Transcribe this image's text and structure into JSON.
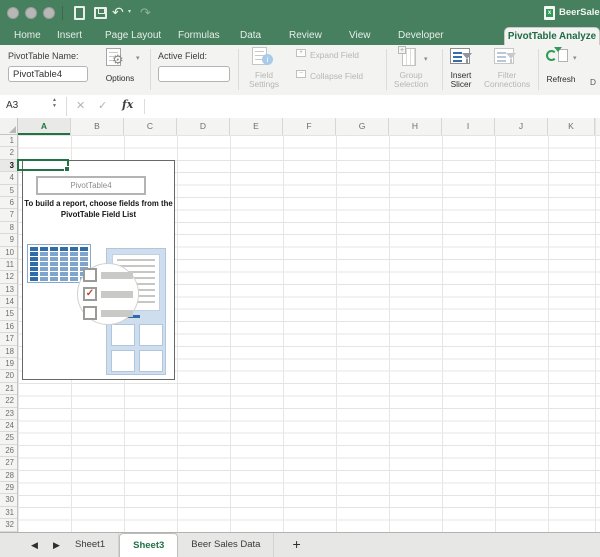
{
  "titlebar": {
    "title": "BeerSalesD"
  },
  "icons": {
    "undo_glyph": "↶",
    "redo_glyph": "↷",
    "caret": "▾",
    "stepper_up": "▲",
    "stepper_down": "▼",
    "cancel": "✕",
    "confirm": "✓",
    "check": "✓",
    "prev": "◀",
    "next": "▶",
    "gear": "⚙",
    "info": "i",
    "plus_small": "+",
    "minus_small": "−",
    "excel_x": "x"
  },
  "ribbon_tabs": {
    "items": [
      "Home",
      "Insert",
      "Page Layout",
      "Formulas",
      "Data",
      "Review",
      "View",
      "Developer",
      "PivotTable Analyze"
    ],
    "active": "PivotTable Analyze"
  },
  "ribbon": {
    "pivottable_name_label": "PivotTable Name:",
    "pivottable_name_value": "PivotTable4",
    "options_label": "Options",
    "active_field_label": "Active Field:",
    "active_field_value": "",
    "field_settings_1": "Field",
    "field_settings_2": "Settings",
    "expand_field": "Expand Field",
    "collapse_field": "Collapse Field",
    "group_selection_1": "Group",
    "group_selection_2": "Selection",
    "insert_slicer_1": "Insert",
    "insert_slicer_2": "Slicer",
    "filter_connections_1": "Filter",
    "filter_connections_2": "Connections",
    "refresh_label": "Refresh",
    "clipped_group_label": "D"
  },
  "formula_bar": {
    "cell_reference": "A3",
    "fx_label": "fx"
  },
  "grid": {
    "columns": [
      "A",
      "B",
      "C",
      "D",
      "E",
      "F",
      "G",
      "H",
      "I",
      "J",
      "K"
    ],
    "row_count": 32,
    "selected_column": "A",
    "selected_row": 3,
    "selected_cell": "A3"
  },
  "pivot_placeholder": {
    "title": "PivotTable4",
    "message_line1": "To build a report, choose fields from the",
    "message_line2": "PivotTable Field List"
  },
  "sheet_tabs": {
    "items": [
      {
        "label": "Sheet1",
        "active": false
      },
      {
        "label": "Sheet3",
        "active": true
      },
      {
        "label": "Beer Sales Data",
        "active": false
      }
    ],
    "add_label": "+"
  },
  "colors": {
    "excel_green": "#217346",
    "titlebar_green": "#47805E",
    "ribbon_bg": "#F3F3F1",
    "accent_blue": "#2F6DA8",
    "panel_blue": "#CFDEEE",
    "check_red": "#C0452E",
    "disabled_text": "#B6B6B4"
  }
}
